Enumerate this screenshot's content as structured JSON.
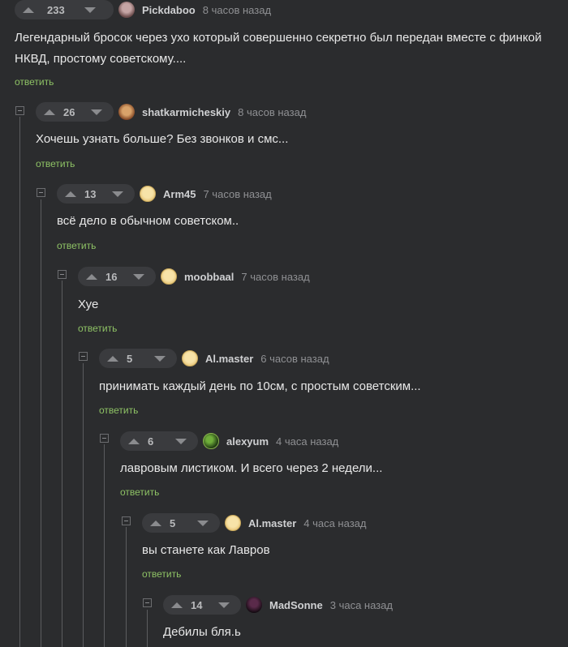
{
  "comments": [
    {
      "score": "233",
      "user": "Pickdaboo",
      "time": "8 часов назад",
      "text": "Легендарный бросок через ухо который совершенно секретно был передан вместе с финкой НКВД, простому советскому....",
      "reply": "ответить",
      "avatar": "pickdaboo-avatar"
    },
    {
      "score": "26",
      "user": "shatkarmicheskiy",
      "time": "8 часов назад",
      "text": "Хочешь узнать больше? Без звонков и смс...",
      "reply": "ответить",
      "avatar": "shatkarmicheskiy-avatar"
    },
    {
      "score": "13",
      "user": "Arm45",
      "time": "7 часов назад",
      "text": "всё дело в обычном советском..",
      "reply": "ответить",
      "avatar": "arm45-avatar"
    },
    {
      "score": "16",
      "user": "moobbaal",
      "time": "7 часов назад",
      "text": "Хуе",
      "reply": "ответить",
      "avatar": "moobbaal-avatar"
    },
    {
      "score": "5",
      "user": "Al.master",
      "time": "6 часов назад",
      "text": "принимать каждый день по 10см, с простым советским...",
      "reply": "ответить",
      "avatar": "almaster-avatar"
    },
    {
      "score": "6",
      "user": "alexyum",
      "time": "4 часа назад",
      "text": "лавровым листиком. И всего через 2 недели...",
      "reply": "ответить",
      "avatar": "alexyum-avatar"
    },
    {
      "score": "5",
      "user": "Al.master",
      "time": "4 часа назад",
      "text": "вы станете как Лавров",
      "reply": "ответить",
      "avatar": "almaster-avatar"
    },
    {
      "score": "14",
      "user": "MadSonne",
      "time": "3 часа назад",
      "text": "Дебилы бля.ь",
      "reply": "",
      "avatar": "madsonne-avatar"
    }
  ],
  "colors": {
    "background": "#2b2c2e",
    "reply_link": "#8ec265",
    "vote_bg": "#3a3b3e"
  }
}
